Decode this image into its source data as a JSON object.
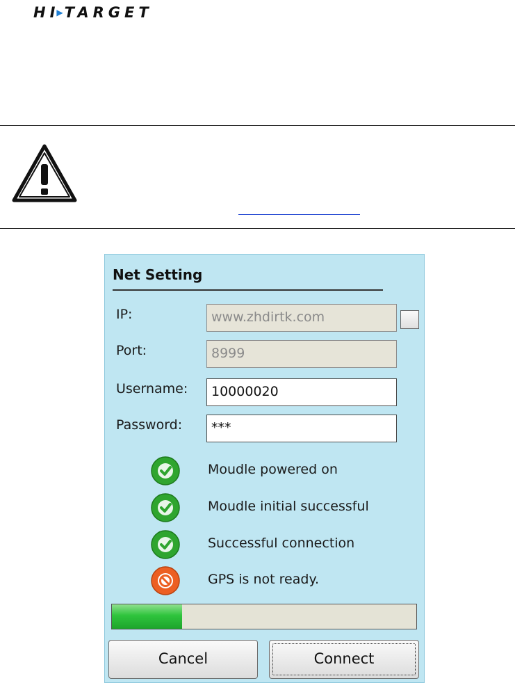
{
  "header": {
    "logo_text_left": "HI",
    "logo_text_right": "TARGET"
  },
  "dialog": {
    "title": "Net Setting",
    "fields": {
      "ip": {
        "label": "IP:",
        "value": "www.zhdirtk.com"
      },
      "port": {
        "label": "Port:",
        "value": "8999"
      },
      "username": {
        "label": "Username:",
        "value": "10000020"
      },
      "password": {
        "label": "Password:",
        "value": "***"
      }
    },
    "status": [
      {
        "text": "Moudle powered on",
        "state": "ok"
      },
      {
        "text": "Moudle initial successful",
        "state": "ok"
      },
      {
        "text": "Successful connection",
        "state": "ok"
      },
      {
        "text": "GPS is not ready.",
        "state": "error"
      }
    ],
    "progress_fraction": 0.23,
    "buttons": {
      "cancel": "Cancel",
      "connect": "Connect"
    }
  },
  "colors": {
    "dialog_bg": "#bfe6f2",
    "ok_green": "#2fa52f",
    "error_orange": "#ec5f22",
    "progress_green": "#2fc43d",
    "logo_accent": "#1f7fd4"
  },
  "icons": {
    "warning": "warning-triangle-icon",
    "ok": "check-circle-icon",
    "error": "prohibited-circle-icon"
  }
}
